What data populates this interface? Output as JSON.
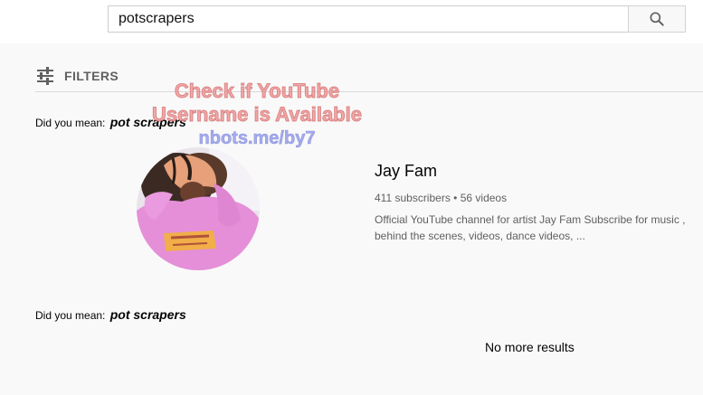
{
  "search": {
    "query": "potscrapers"
  },
  "filters": {
    "label": "FILTERS"
  },
  "did_you_mean": [
    {
      "prefix": "Did you mean:",
      "suggestion": "pot scrapers"
    },
    {
      "prefix": "Did you mean:",
      "suggestion": "pot scrapers"
    }
  ],
  "watermark": {
    "line1": "Check if YouTube",
    "line2": "Username is Available",
    "link": "nbots.me/by7"
  },
  "channel": {
    "name": "Jay Fam",
    "subscribers": "411 subscribers",
    "separator": "•",
    "videos": "56 videos",
    "description": "Official YouTube channel for artist Jay Fam Subscribe for music , behind the scenes, videos, dance videos, ..."
  },
  "footer": {
    "no_more_results": "No more results"
  },
  "icons": {
    "search": "search-icon",
    "filters": "filter-sliders-icon"
  },
  "colors": {
    "page_bg": "#f9f9f9",
    "secondary_text": "#606060",
    "avatar_pink": "#e58fd8",
    "avatar_yellow": "#f2b13a"
  }
}
